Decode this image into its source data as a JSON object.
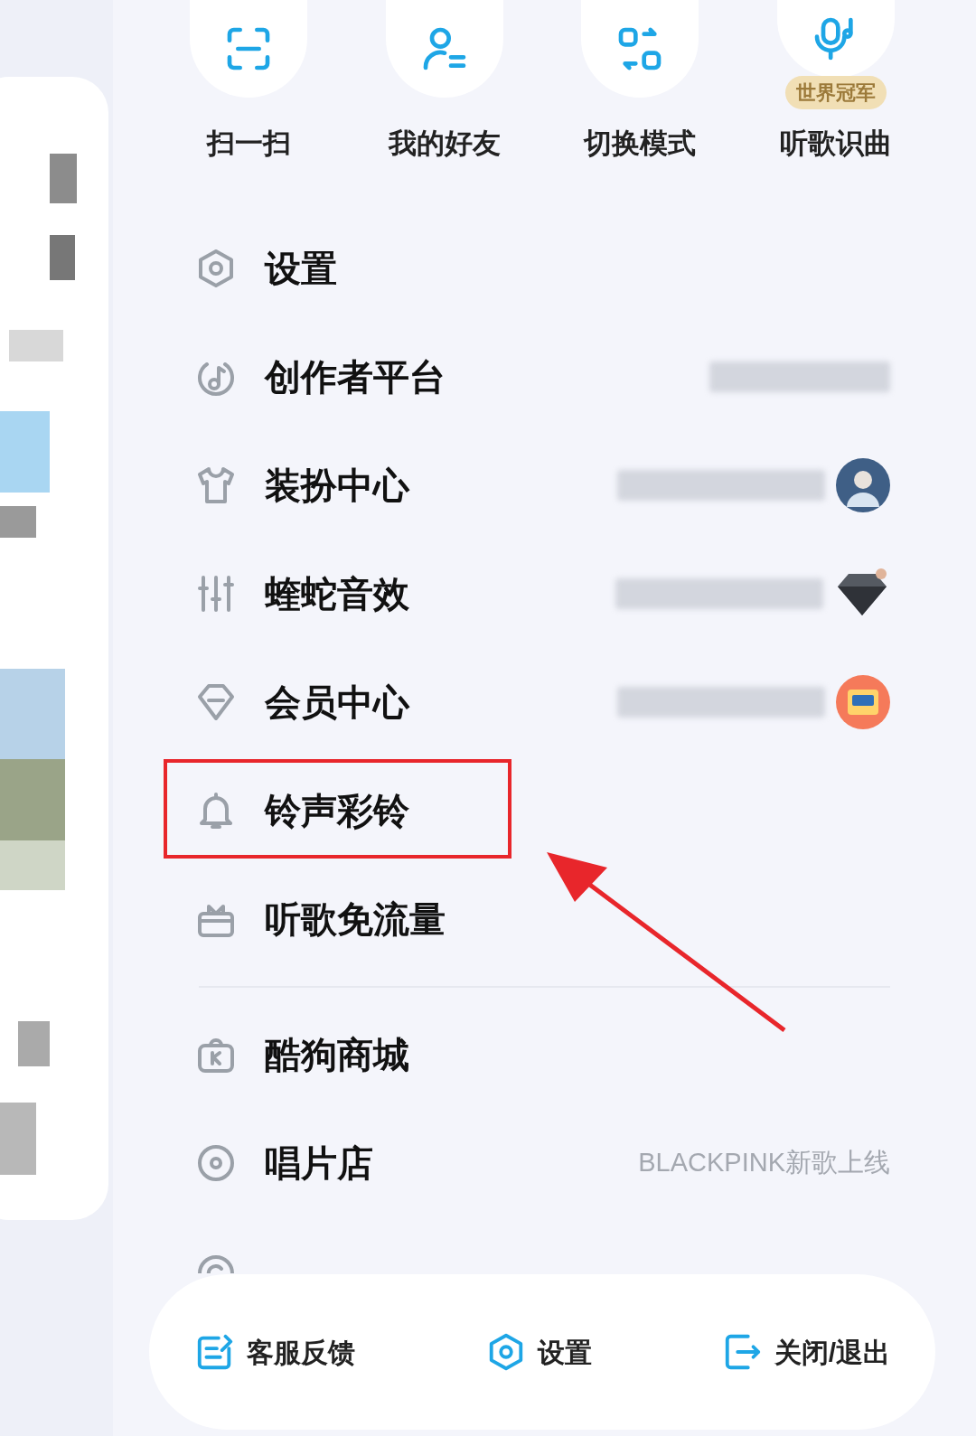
{
  "quick_actions": [
    {
      "label": "扫一扫"
    },
    {
      "label": "我的好友"
    },
    {
      "label": "切换模式"
    },
    {
      "label": "听歌识曲",
      "tag": "世界冠军"
    }
  ],
  "menu": [
    {
      "label": "设置",
      "highlighted": false
    },
    {
      "label": "创作者平台",
      "highlighted": false
    },
    {
      "label": "装扮中心",
      "highlighted": false
    },
    {
      "label": "蝰蛇音效",
      "highlighted": false
    },
    {
      "label": "会员中心",
      "highlighted": false
    },
    {
      "label": "铃声彩铃",
      "highlighted": true
    },
    {
      "label": "听歌免流量",
      "highlighted": false
    },
    {
      "kind": "divider"
    },
    {
      "label": "酷狗商城",
      "highlighted": false
    },
    {
      "label": "唱片店",
      "note": "BLACKPINK新歌上线",
      "highlighted": false
    }
  ],
  "bottom_bar": [
    {
      "label": "客服反馈"
    },
    {
      "label": "设置"
    },
    {
      "label": "关闭/退出"
    }
  ]
}
